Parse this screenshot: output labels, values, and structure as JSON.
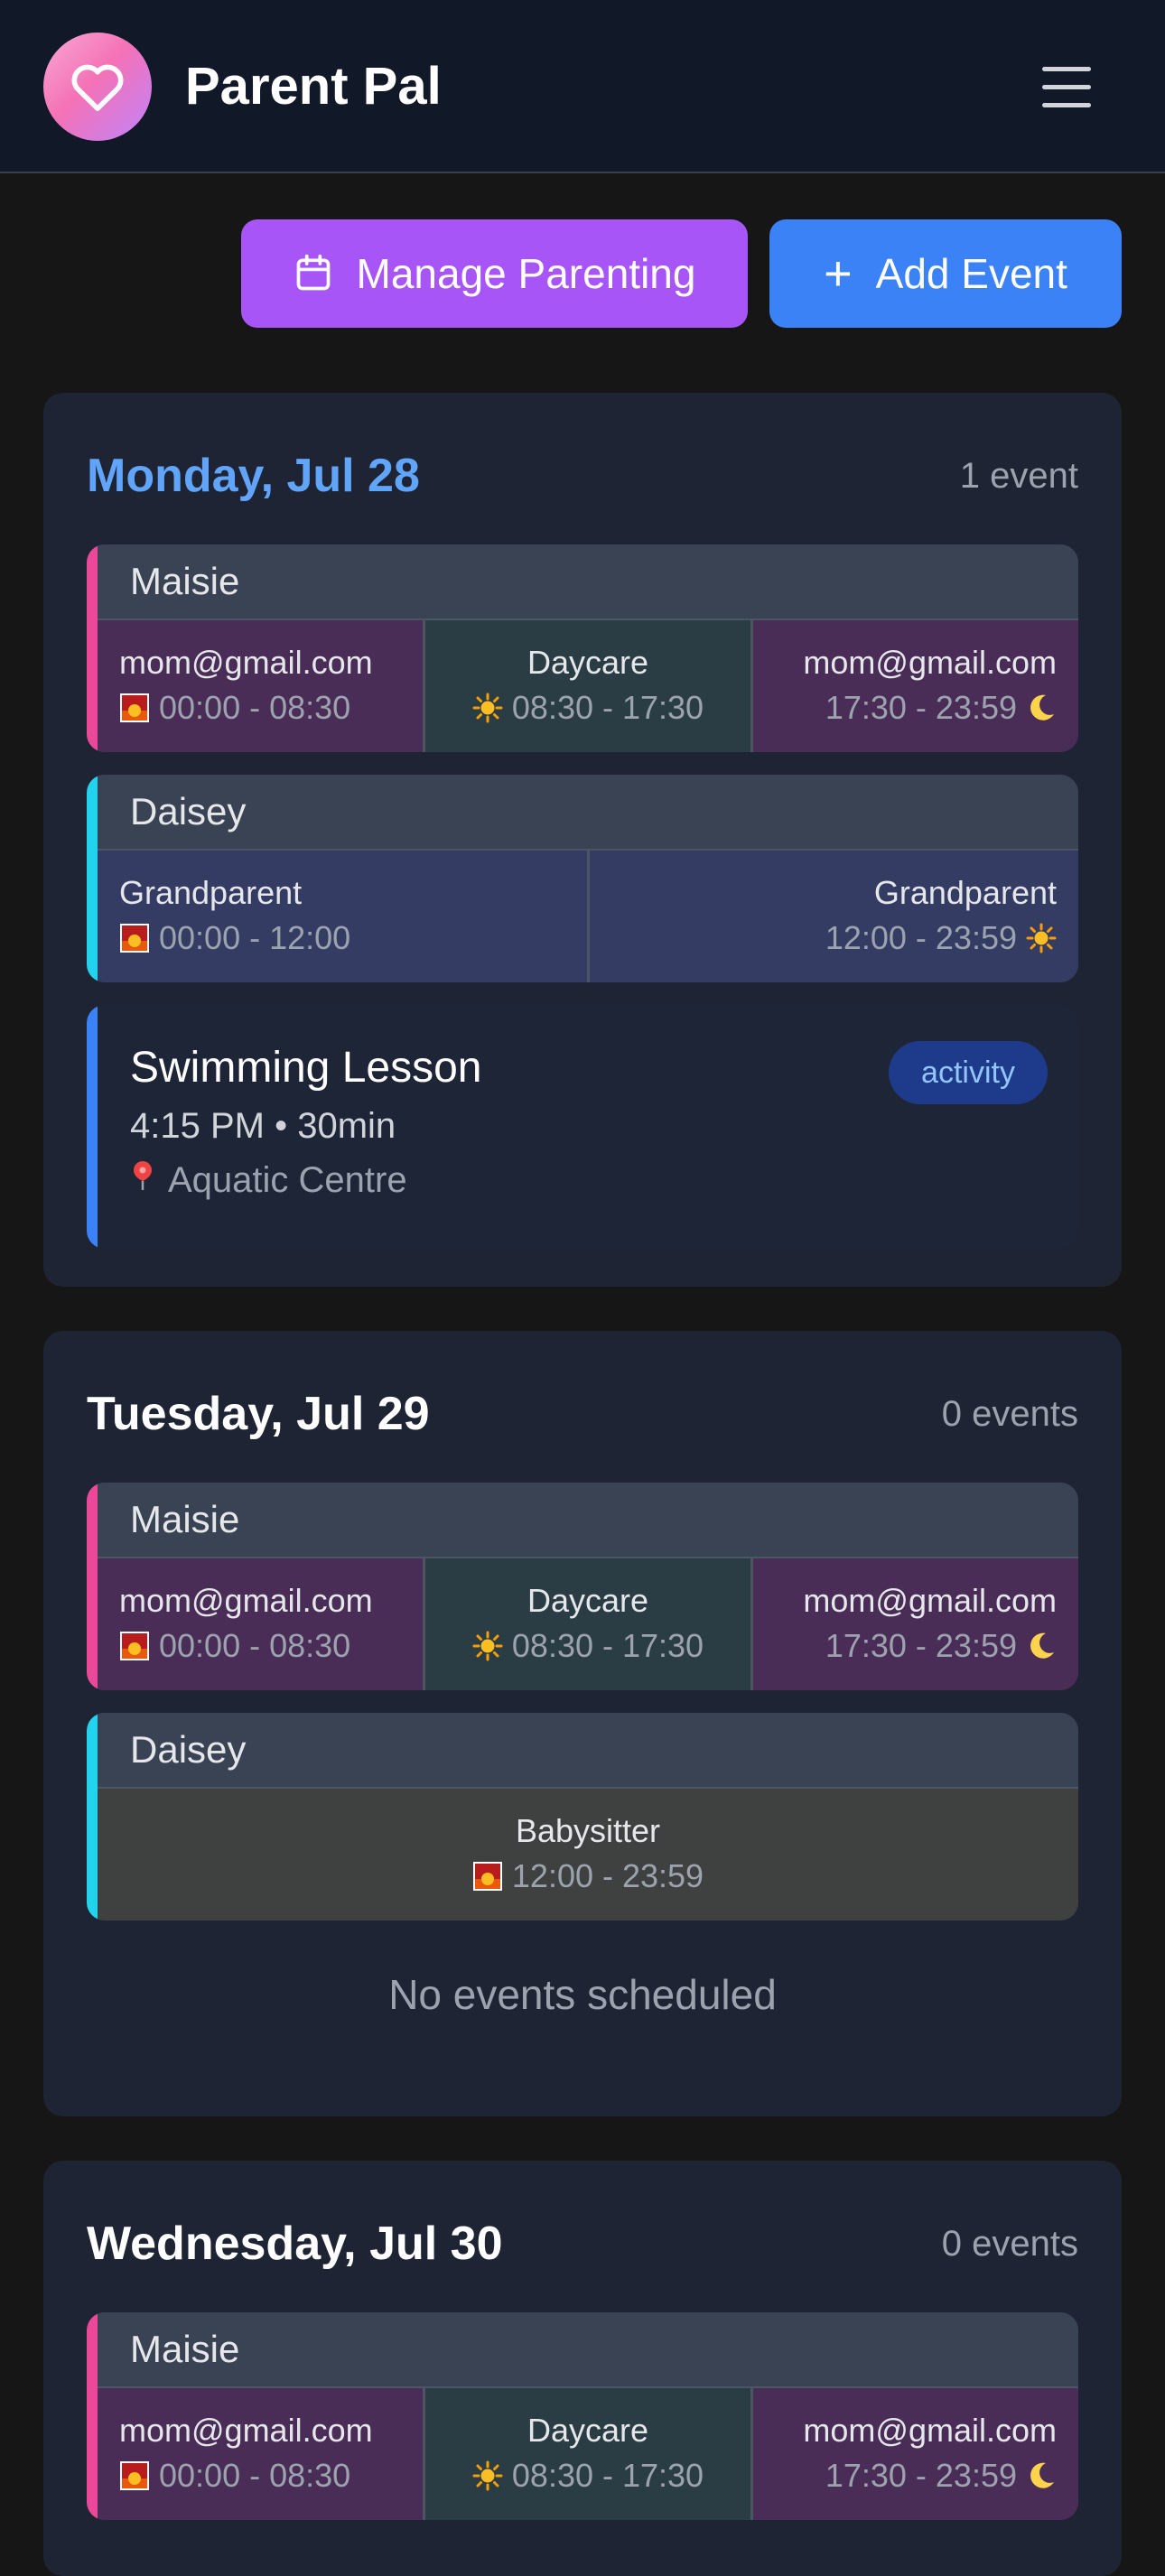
{
  "app": {
    "title": "Parent Pal",
    "logo_icon": "heart-icon",
    "menu_icon": "hamburger-menu-icon"
  },
  "actions": {
    "manage_label": "Manage Parenting",
    "manage_icon": "calendar-icon",
    "add_label": "Add Event",
    "add_icon": "plus-icon"
  },
  "colors": {
    "maisie_accent": "#ec4899",
    "daisey_accent": "#22d3ee",
    "event_accent": "#3b82f6",
    "manage_button": "#a855f7",
    "add_button": "#3b82f6",
    "today_heading": "#60a5fa"
  },
  "days": [
    {
      "title": "Monday, Jul 28",
      "count": "1 event",
      "children": [
        {
          "name": "Maisie",
          "slots": [
            {
              "who": "mom@gmail.com",
              "time": "00:00 - 08:30",
              "icon": "sunrise-icon"
            },
            {
              "who": "Daycare",
              "time": "08:30 - 17:30",
              "icon": "sun-icon"
            },
            {
              "who": "mom@gmail.com",
              "time": "17:30 - 23:59",
              "icon": "moon-icon"
            }
          ]
        },
        {
          "name": "Daisey",
          "slots": [
            {
              "who": "Grandparent",
              "time": "00:00 - 12:00",
              "icon": "sunrise-icon"
            },
            {
              "who": "Grandparent",
              "time": "12:00 - 23:59",
              "icon": "sun-icon"
            }
          ]
        }
      ],
      "events": [
        {
          "title": "Swimming Lesson",
          "time": "4:15 PM • 30min",
          "location": "Aquatic Centre",
          "location_icon": "pin-icon",
          "tag": "activity"
        }
      ]
    },
    {
      "title": "Tuesday, Jul 29",
      "count": "0 events",
      "children": [
        {
          "name": "Maisie",
          "slots": [
            {
              "who": "mom@gmail.com",
              "time": "00:00 - 08:30",
              "icon": "sunrise-icon"
            },
            {
              "who": "Daycare",
              "time": "08:30 - 17:30",
              "icon": "sun-icon"
            },
            {
              "who": "mom@gmail.com",
              "time": "17:30 - 23:59",
              "icon": "moon-icon"
            }
          ]
        },
        {
          "name": "Daisey",
          "slots": [
            {
              "who": "Babysitter",
              "time": "12:00 - 23:59",
              "icon": "sunrise-icon"
            }
          ]
        }
      ],
      "empty_message": "No events scheduled"
    },
    {
      "title": "Wednesday, Jul 30",
      "count": "0 events",
      "children": [
        {
          "name": "Maisie",
          "slots": [
            {
              "who": "mom@gmail.com",
              "time": "00:00 - 08:30",
              "icon": "sunrise-icon"
            },
            {
              "who": "Daycare",
              "time": "08:30 - 17:30",
              "icon": "sun-icon"
            },
            {
              "who": "mom@gmail.com",
              "time": "17:30 - 23:59",
              "icon": "moon-icon"
            }
          ]
        }
      ]
    }
  ]
}
